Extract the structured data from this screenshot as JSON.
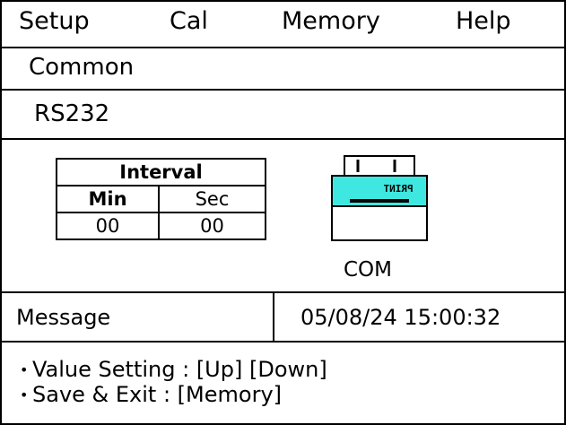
{
  "menu": {
    "items": [
      "Setup",
      "Cal",
      "Memory",
      "Help"
    ]
  },
  "breadcrumb": {
    "level1": "Common",
    "level2": "RS232"
  },
  "interval": {
    "title": "Interval",
    "min_label": "Min",
    "sec_label": "Sec",
    "min_value": "00",
    "sec_value": "00"
  },
  "device": {
    "printer_label": "PRINT",
    "icon": "printer-icon",
    "port_label": "COM",
    "accent_color": "#3ee8e0"
  },
  "status": {
    "message_label": "Message",
    "datetime": "05/08/24 15:00:32"
  },
  "help": {
    "bullet": "•",
    "line1": "Value Setting : [Up] [Down]",
    "line2": "Save &  Exit : [Memory]"
  }
}
